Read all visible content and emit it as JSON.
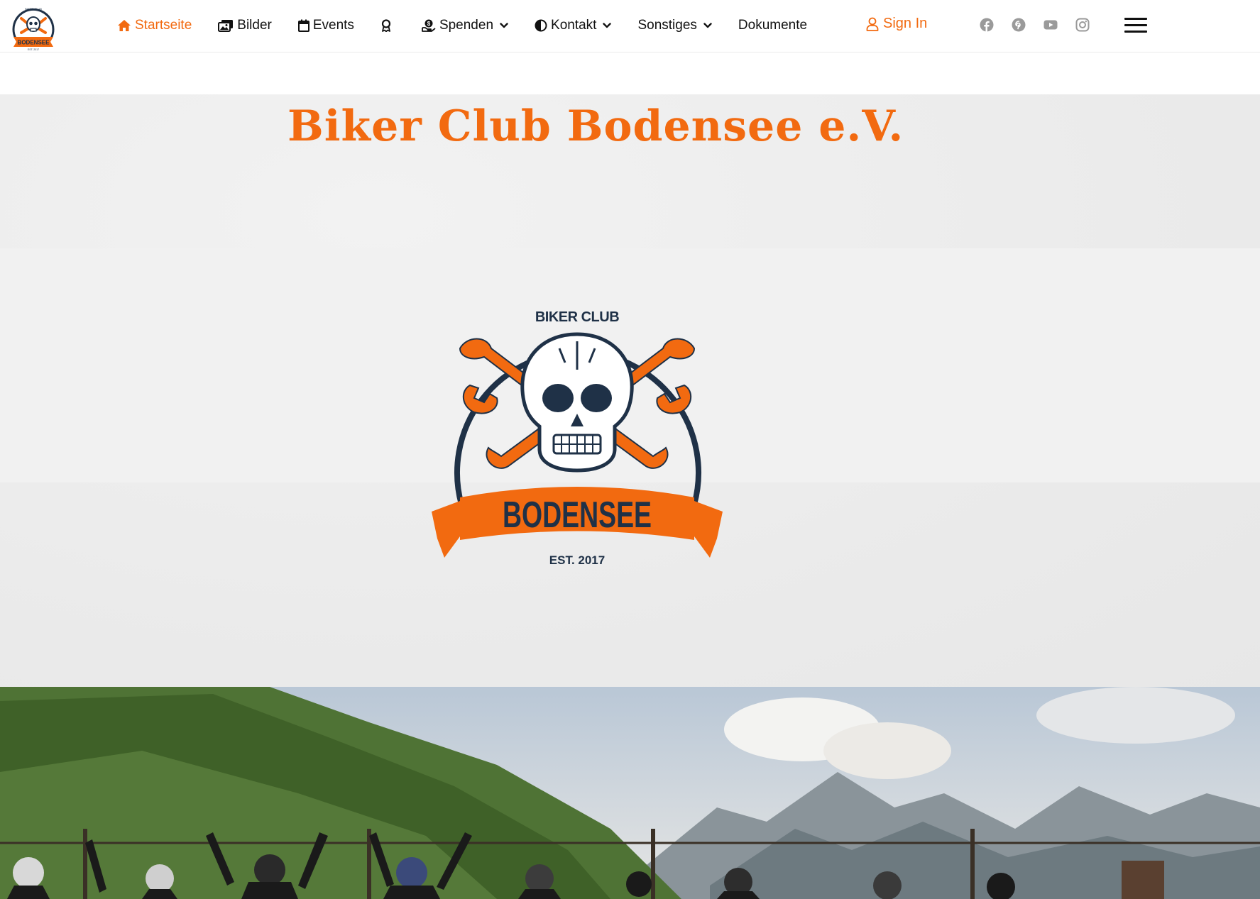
{
  "nav": {
    "items": [
      {
        "label": "Startseite",
        "icon": "home-icon",
        "active": true,
        "dropdown": false
      },
      {
        "label": "Bilder",
        "icon": "images-icon",
        "active": false,
        "dropdown": false
      },
      {
        "label": "Events",
        "icon": "calendar-icon",
        "active": false,
        "dropdown": false
      },
      {
        "label": "",
        "icon": "award-icon",
        "active": false,
        "dropdown": false
      },
      {
        "label": "Spenden",
        "icon": "donate-icon",
        "active": false,
        "dropdown": true
      },
      {
        "label": "Kontakt",
        "icon": "contrast-icon",
        "active": false,
        "dropdown": true
      },
      {
        "label": "Sonstiges",
        "icon": "",
        "active": false,
        "dropdown": true
      },
      {
        "label": "Dokumente",
        "icon": "",
        "active": false,
        "dropdown": false
      }
    ],
    "signin_label": "Sign In",
    "socials": [
      "facebook-icon",
      "pinterest-icon",
      "youtube-icon",
      "instagram-icon"
    ]
  },
  "hero": {
    "title": "Biker Club Bodensee e.V."
  },
  "logo": {
    "top_text": "BIKER CLUB",
    "banner_text": "BODENSEE",
    "bottom_text": "EST. 2017"
  },
  "colors": {
    "accent": "#f26a10",
    "navy": "#1f3147",
    "text": "#111111",
    "social_gray": "#9a9a9a"
  }
}
